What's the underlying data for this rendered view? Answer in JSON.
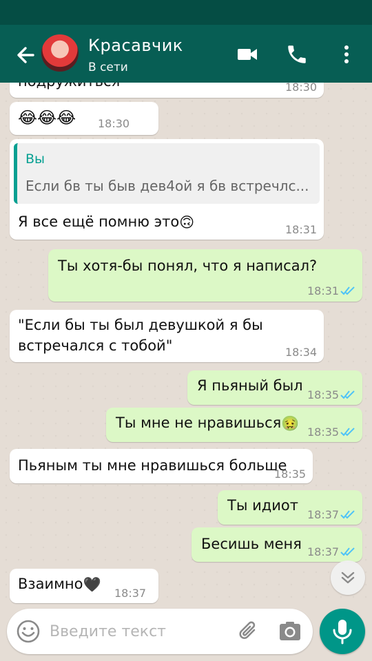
{
  "header": {
    "contact_name": "Красавчик",
    "status": "В сети",
    "icons": [
      "back-arrow-icon",
      "video-call-icon",
      "phone-icon",
      "more-vert-icon"
    ]
  },
  "messages": [
    {
      "dir": "in",
      "text": "подружиться",
      "time": "18:30"
    },
    {
      "dir": "in",
      "text": "😂😂😂",
      "time": "18:30"
    },
    {
      "dir": "in",
      "reply_author": "Вы",
      "reply_text": "Если бв ты быв дев4ой я бв встречлс...",
      "text": "Я все ещё помню это",
      "emoji": "🙃",
      "time": "18:31"
    },
    {
      "dir": "out",
      "text": "Ты хотя-бы понял, что я написал?",
      "time": "18:31",
      "status": "read"
    },
    {
      "dir": "in",
      "text_line1": "\"Если бы ты был девушкой я бы",
      "text_line2": "встречался с тобой\"",
      "time": "18:34"
    },
    {
      "dir": "out",
      "text": "Я пьяный был",
      "time": "18:35",
      "status": "read"
    },
    {
      "dir": "out",
      "text": "Ты мне не нравишься",
      "emoji": "🤢",
      "time": "18:35",
      "status": "read"
    },
    {
      "dir": "in",
      "text": "Пьяным ты мне нравишься больше",
      "time": "18:35"
    },
    {
      "dir": "out",
      "text": "Ты идиот",
      "time": "18:37",
      "status": "read"
    },
    {
      "dir": "out",
      "text": "Бесишь меня",
      "time": "18:37",
      "status": "read"
    },
    {
      "dir": "in",
      "text": "Взаимно",
      "emoji": "🖤",
      "time": "18:37"
    }
  ],
  "composer": {
    "placeholder": "Введите текст",
    "icons": [
      "emoji-icon",
      "paperclip-icon",
      "camera-icon",
      "mic-icon",
      "chevron-down-icon"
    ]
  },
  "colors": {
    "header": "#075e54",
    "statusbar": "#054d44",
    "incoming_bubble": "#ffffff",
    "outgoing_bubble": "#dcf8c6",
    "read_ticks": "#4fc3f7",
    "accent": "#009688"
  }
}
